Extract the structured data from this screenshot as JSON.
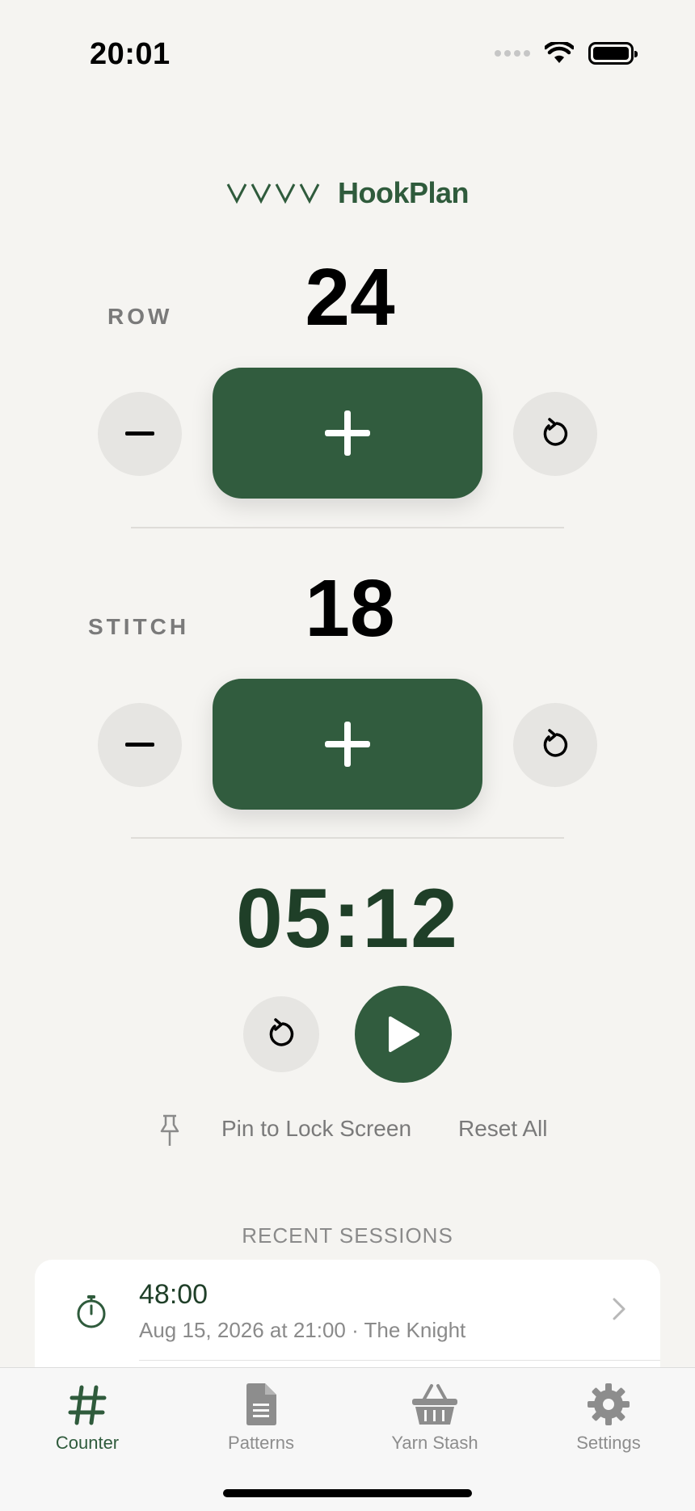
{
  "status_bar": {
    "time": "20:01"
  },
  "header": {
    "brand": "HookPlan"
  },
  "row_counter": {
    "label": "ROW",
    "value": "24"
  },
  "stitch_counter": {
    "label": "STITCH",
    "value": "18"
  },
  "timer": {
    "value": "05:12"
  },
  "actions": {
    "pin_label": "Pin to Lock Screen",
    "reset_all_label": "Reset All"
  },
  "recent_sessions": {
    "title": "RECENT SESSIONS",
    "items": [
      {
        "duration": "48:00",
        "details": "Aug 15, 2026 at 21:00 · The Knight"
      }
    ]
  },
  "tabbar": {
    "items": [
      {
        "label": "Counter",
        "icon": "hash-icon",
        "active": true
      },
      {
        "label": "Patterns",
        "icon": "document-icon",
        "active": false
      },
      {
        "label": "Yarn Stash",
        "icon": "basket-icon",
        "active": false
      },
      {
        "label": "Settings",
        "icon": "gear-icon",
        "active": false
      }
    ]
  },
  "colors": {
    "accent": "#315c3e",
    "background": "#f5f4f1",
    "timer_text": "#1f3f28"
  }
}
